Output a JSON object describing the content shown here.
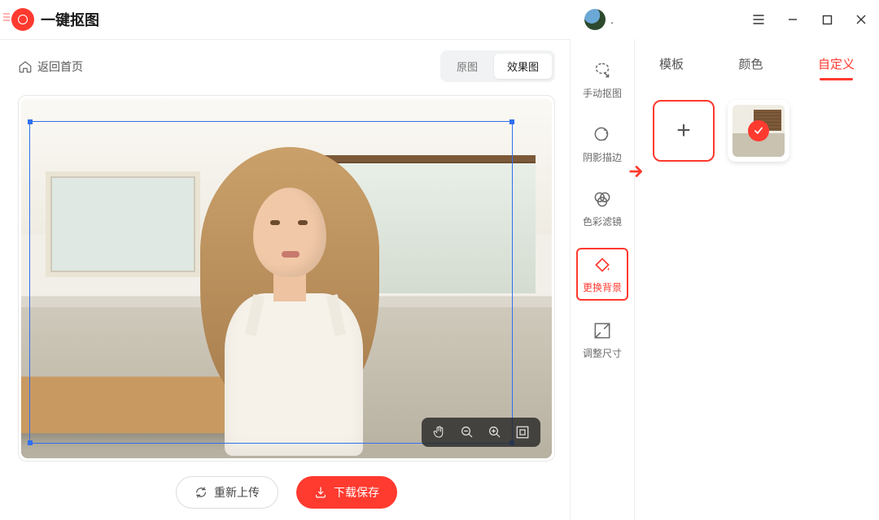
{
  "app": {
    "title": "一键抠图"
  },
  "window": {
    "menu_icon": "menu",
    "minimize": "−",
    "maximize": "□",
    "close": "×"
  },
  "header": {
    "back_label": "返回首页",
    "seg_original": "原图",
    "seg_result": "效果图"
  },
  "canvas_tools": {
    "pan": "pan",
    "zoom_out": "缩小",
    "zoom_in": "放大",
    "fit": "适应"
  },
  "actions": {
    "reupload": "重新上传",
    "download": "下载保存"
  },
  "rail": {
    "manual": "手动抠图",
    "shadow": "阴影描边",
    "filter": "色彩滤镜",
    "background": "更换背景",
    "resize": "调整尺寸"
  },
  "panel": {
    "tab_template": "模板",
    "tab_color": "颜色",
    "tab_custom": "自定义",
    "add_label": "+"
  },
  "colors": {
    "accent": "#ff3a2f",
    "selection": "#2f6fed"
  }
}
